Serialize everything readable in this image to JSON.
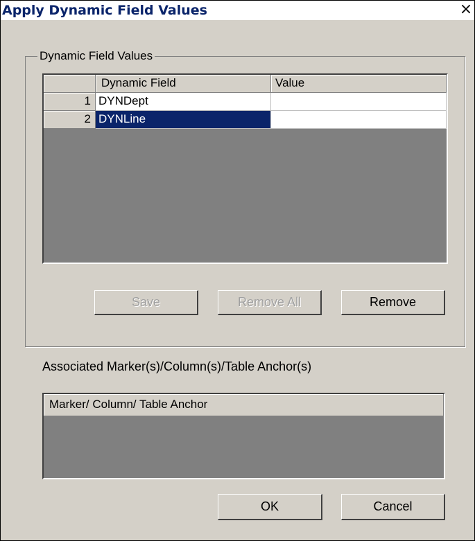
{
  "window": {
    "title": "Apply Dynamic Field Values",
    "close_glyph": "×"
  },
  "group": {
    "legend": "Dynamic Field Values"
  },
  "grid": {
    "columns": [
      "Dynamic Field",
      "Value"
    ],
    "rows": [
      {
        "num": "1",
        "field": "DYNDept",
        "value": "",
        "selected": false
      },
      {
        "num": "2",
        "field": "DYNLine",
        "value": "",
        "selected": true
      }
    ]
  },
  "buttons": {
    "save": "Save",
    "remove_all": "Remove All",
    "remove": "Remove",
    "ok": "OK",
    "cancel": "Cancel"
  },
  "associated": {
    "label": "Associated Marker(s)/Column(s)/Table Anchor(s)",
    "column": "Marker/ Column/ Table Anchor"
  },
  "colors": {
    "dialog_bg": "#d4d0c8",
    "selection": "#0a246a",
    "grid_empty": "#808080",
    "title_text": "#0a246a"
  }
}
